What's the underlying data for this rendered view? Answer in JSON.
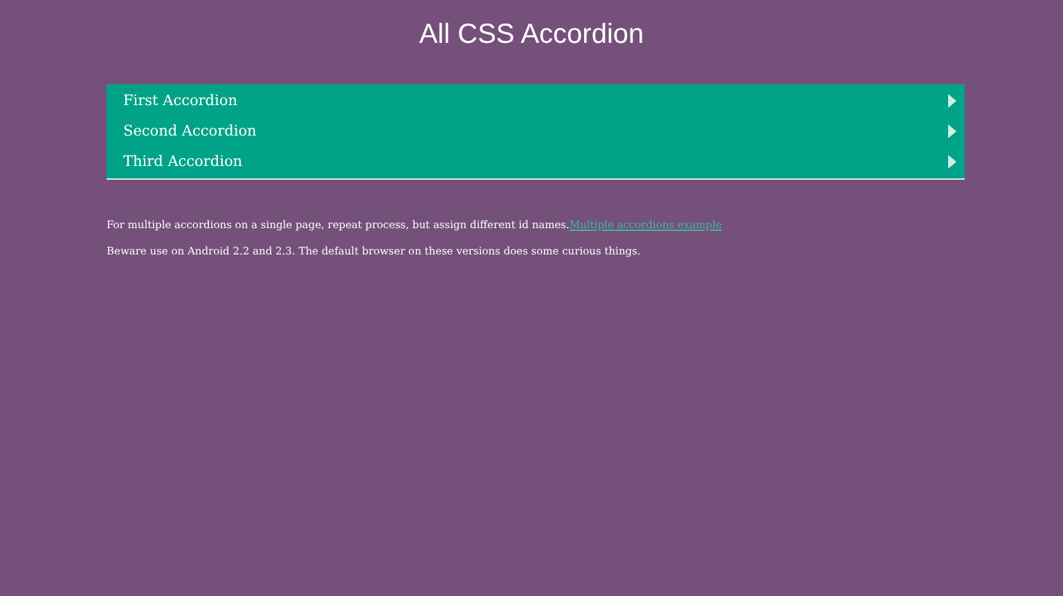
{
  "title": "All CSS Accordion",
  "accordion": [
    {
      "label": "First Accordion",
      "expanded": false
    },
    {
      "label": "Second Accordion",
      "expanded": false
    },
    {
      "label": "Third Accordion",
      "expanded": false
    }
  ],
  "notes": [
    {
      "text": "For multiple accordions on a single page, repeat process, but assign different id names.",
      "link": "Multiple accordions example"
    },
    {
      "text": "Beware use on Android 2.2 and 2.3. The default browser on these versions does some curious things."
    }
  ]
}
